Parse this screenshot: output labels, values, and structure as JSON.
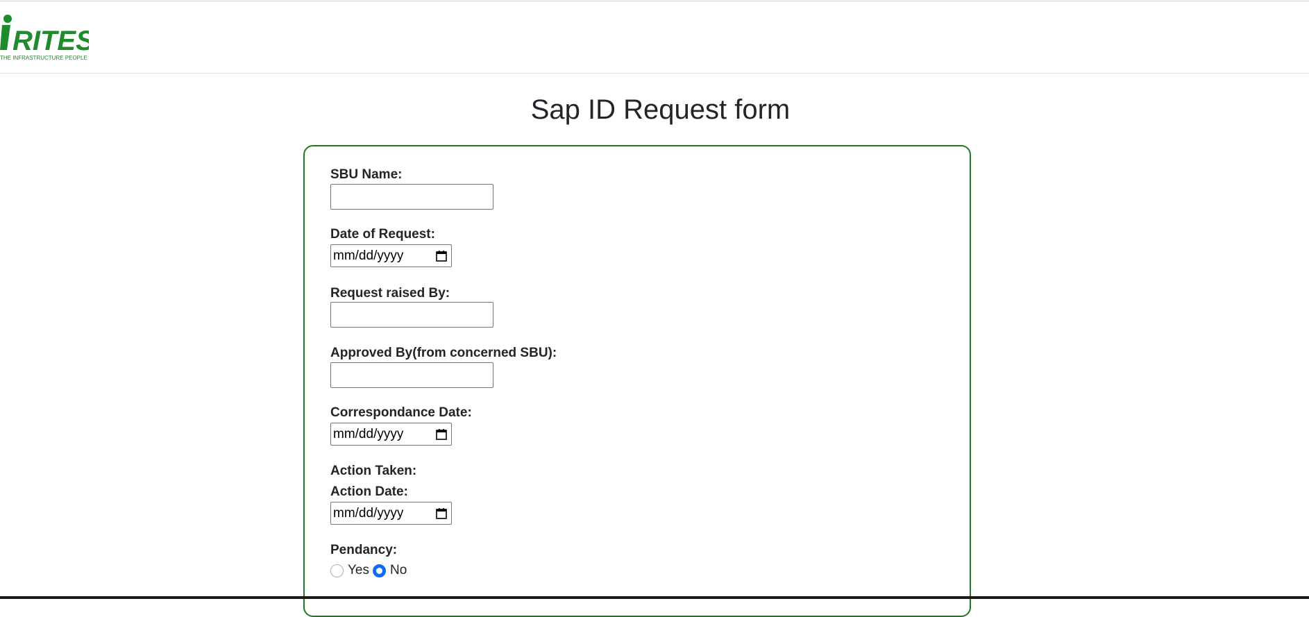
{
  "header": {
    "logo_text": "RITES",
    "logo_tagline": "THE INFRASTRUCTURE PEOPLE"
  },
  "page": {
    "title": "Sap ID Request form"
  },
  "form": {
    "sbu_name": {
      "label": "SBU Name:",
      "value": ""
    },
    "date_of_request": {
      "label": "Date of Request:",
      "value": "mm/dd/yyyy"
    },
    "request_raised_by": {
      "label": "Request raised By:",
      "value": ""
    },
    "approved_by": {
      "label": "Approved By(from concerned SBU):",
      "value": ""
    },
    "correspondance_date": {
      "label": "Correspondance Date:",
      "value": "mm/dd/yyyy"
    },
    "action_taken": {
      "label": "Action Taken:"
    },
    "action_date": {
      "label": "Action Date:",
      "value": "mm/dd/yyyy"
    },
    "pendancy": {
      "label": "Pendancy:",
      "options": [
        "Yes",
        "No"
      ],
      "selected": "No"
    }
  },
  "colors": {
    "brand_green": "#1f8a2e",
    "card_border": "#1f7a1f",
    "radio_accent": "#0b6cff"
  }
}
